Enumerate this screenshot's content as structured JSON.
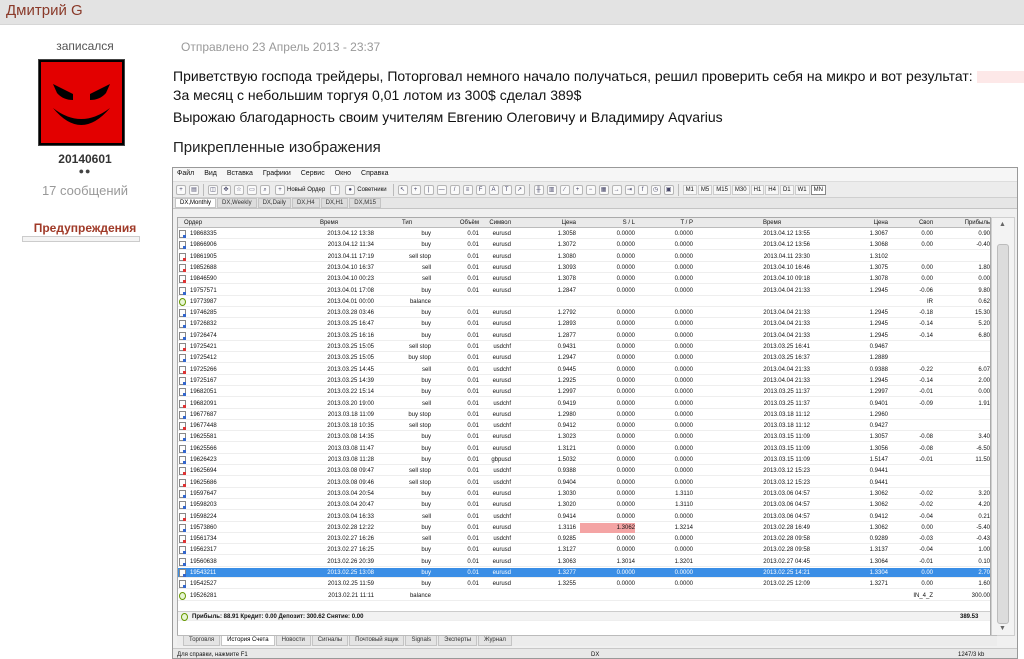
{
  "page": {
    "author": "Дмитрий G"
  },
  "user": {
    "joined_label": "записался",
    "user_id": "20140601",
    "dots": "●●",
    "messages": "17 сообщений",
    "warnings_label": "Предупреждения"
  },
  "post": {
    "date": "Отправлено 23 Апрель 2013 - 23:37",
    "line1": "Приветствую господа трейдеры, Поторговал  немного начало получаться, решил проверить себя на микро и вот результат:",
    "line2": "За месяц с небольшим торгуя 0,01 лотом из 300$ сделал 389$",
    "line3": "Вырожаю благодарность своим учителям Евгению Олеговичу и Владимиру Aqvarius",
    "attachments_title": "Прикрепленные изображения"
  },
  "terminal": {
    "menu": [
      "Файл",
      "Вид",
      "Вставка",
      "Графики",
      "Сервис",
      "Окно",
      "Справка"
    ],
    "toolbar": {
      "new_order": "Новый Ордер",
      "advisors": "Советники",
      "timeframes": [
        "M1",
        "M5",
        "M15",
        "M30",
        "H1",
        "H4",
        "D1",
        "W1",
        "MN"
      ]
    },
    "chart_tabs": [
      "DX,Monthly",
      "DX,Weekly",
      "DX,Daily",
      "DX,H4",
      "DX,H1",
      "DX,M15"
    ],
    "columns": [
      "Ордер",
      "Время",
      "Тип",
      "Объём",
      "Символ",
      "Цена",
      "S / L",
      "T / P",
      "Время",
      "Цена",
      "Своп",
      "Прибыль"
    ],
    "rows": [
      [
        "19868335",
        "2013.04.12 13:38",
        "buy",
        "0.01",
        "eurusd",
        "1.3058",
        "0.0000",
        "0.0000",
        "2013.04.12 13:55",
        "1.3067",
        "0.00",
        "0.90"
      ],
      [
        "19866906",
        "2013.04.12 11:34",
        "buy",
        "0.01",
        "eurusd",
        "1.3072",
        "0.0000",
        "0.0000",
        "2013.04.12 13:56",
        "1.3068",
        "0.00",
        "-0.40"
      ],
      [
        "19861905",
        "2013.04.11 17:19",
        "sell stop",
        "0.01",
        "eurusd",
        "1.3080",
        "0.0000",
        "0.0000",
        "2013.04.11 23:30",
        "1.3102",
        "",
        ""
      ],
      [
        "19852688",
        "2013.04.10 16:37",
        "sell",
        "0.01",
        "eurusd",
        "1.3093",
        "0.0000",
        "0.0000",
        "2013.04.10 16:46",
        "1.3075",
        "0.00",
        "1.80"
      ],
      [
        "19846590",
        "2013.04.10 00:23",
        "sell",
        "0.01",
        "eurusd",
        "1.3078",
        "0.0000",
        "0.0000",
        "2013.04.10 09:18",
        "1.3078",
        "0.00",
        "0.00"
      ],
      [
        "19757571",
        "2013.04.01 17:08",
        "buy",
        "0.01",
        "eurusd",
        "1.2847",
        "0.0000",
        "0.0000",
        "2013.04.04 21:33",
        "1.2945",
        "-0.06",
        "9.80"
      ],
      [
        "19773987",
        "2013.04.01 00:00",
        "balance",
        "",
        "",
        "",
        "",
        "",
        "",
        "",
        "IR",
        "0.62"
      ],
      [
        "19746285",
        "2013.03.28 03:46",
        "buy",
        "0.01",
        "eurusd",
        "1.2792",
        "0.0000",
        "0.0000",
        "2013.04.04 21:33",
        "1.2945",
        "-0.18",
        "15.30"
      ],
      [
        "19726832",
        "2013.03.25 16:47",
        "buy",
        "0.01",
        "eurusd",
        "1.2893",
        "0.0000",
        "0.0000",
        "2013.04.04 21:33",
        "1.2945",
        "-0.14",
        "5.20"
      ],
      [
        "19726474",
        "2013.03.25 16:16",
        "buy",
        "0.01",
        "eurusd",
        "1.2877",
        "0.0000",
        "0.0000",
        "2013.04.04 21:33",
        "1.2945",
        "-0.14",
        "6.80"
      ],
      [
        "19725421",
        "2013.03.25 15:05",
        "sell stop",
        "0.01",
        "usdchf",
        "0.9431",
        "0.0000",
        "0.0000",
        "2013.03.25 16:41",
        "0.9467",
        "",
        ""
      ],
      [
        "19725412",
        "2013.03.25 15:05",
        "buy stop",
        "0.01",
        "eurusd",
        "1.2947",
        "0.0000",
        "0.0000",
        "2013.03.25 16:37",
        "1.2889",
        "",
        ""
      ],
      [
        "19725266",
        "2013.03.25 14:45",
        "sell",
        "0.01",
        "usdchf",
        "0.9445",
        "0.0000",
        "0.0000",
        "2013.04.04 21:33",
        "0.9388",
        "-0.22",
        "6.07"
      ],
      [
        "19725167",
        "2013.03.25 14:39",
        "buy",
        "0.01",
        "eurusd",
        "1.2925",
        "0.0000",
        "0.0000",
        "2013.04.04 21:33",
        "1.2945",
        "-0.14",
        "2.00"
      ],
      [
        "19682051",
        "2013.03.22 15:14",
        "buy",
        "0.01",
        "eurusd",
        "1.2997",
        "0.0000",
        "0.0000",
        "2013.03.25 11:37",
        "1.2997",
        "-0.01",
        "0.00"
      ],
      [
        "19682091",
        "2013.03.20 19:00",
        "sell",
        "0.01",
        "usdchf",
        "0.9419",
        "0.0000",
        "0.0000",
        "2013.03.25 11:37",
        "0.9401",
        "-0.09",
        "1.91"
      ],
      [
        "19677687",
        "2013.03.18 11:09",
        "buy stop",
        "0.01",
        "eurusd",
        "1.2980",
        "0.0000",
        "0.0000",
        "2013.03.18 11:12",
        "1.2960",
        "",
        ""
      ],
      [
        "19677448",
        "2013.03.18 10:35",
        "sell stop",
        "0.01",
        "usdchf",
        "0.9412",
        "0.0000",
        "0.0000",
        "2013.03.18 11:12",
        "0.9427",
        "",
        ""
      ],
      [
        "19625581",
        "2013.03.08 14:35",
        "buy",
        "0.01",
        "eurusd",
        "1.3023",
        "0.0000",
        "0.0000",
        "2013.03.15 11:09",
        "1.3057",
        "-0.08",
        "3.40"
      ],
      [
        "19625566",
        "2013.03.08 11:47",
        "buy",
        "0.01",
        "eurusd",
        "1.3121",
        "0.0000",
        "0.0000",
        "2013.03.15 11:09",
        "1.3056",
        "-0.08",
        "-6.50"
      ],
      [
        "19626423",
        "2013.03.08 11:28",
        "buy",
        "0.01",
        "gbpusd",
        "1.5032",
        "0.0000",
        "0.0000",
        "2013.03.15 11:09",
        "1.5147",
        "-0.01",
        "11.50"
      ],
      [
        "19625694",
        "2013.03.08 09:47",
        "sell stop",
        "0.01",
        "usdchf",
        "0.9388",
        "0.0000",
        "0.0000",
        "2013.03.12 15:23",
        "0.9441",
        "",
        ""
      ],
      [
        "19625686",
        "2013.03.08 09:46",
        "sell stop",
        "0.01",
        "usdchf",
        "0.9404",
        "0.0000",
        "0.0000",
        "2013.03.12 15:23",
        "0.9441",
        "",
        ""
      ],
      [
        "19597647",
        "2013.03.04 20:54",
        "buy",
        "0.01",
        "eurusd",
        "1.3030",
        "0.0000",
        "1.3110",
        "2013.03.06 04:57",
        "1.3062",
        "-0.02",
        "3.20"
      ],
      [
        "19598203",
        "2013.03.04 20:47",
        "buy",
        "0.01",
        "eurusd",
        "1.3020",
        "0.0000",
        "1.3110",
        "2013.03.06 04:57",
        "1.3062",
        "-0.02",
        "4.20"
      ],
      [
        "19598224",
        "2013.03.04 16:33",
        "sell",
        "0.01",
        "usdchf",
        "0.9414",
        "0.0000",
        "0.0000",
        "2013.03.06 04:57",
        "0.9412",
        "-0.04",
        "0.21"
      ],
      [
        "19573860",
        "2013.02.28 12:22",
        "buy",
        "0.01",
        "eurusd",
        "1.3116",
        "1.3062",
        "1.3214",
        "2013.02.28 16:49",
        "1.3062",
        "0.00",
        "-5.40"
      ],
      [
        "19561734",
        "2013.02.27 16:26",
        "sell",
        "0.01",
        "usdchf",
        "0.9285",
        "0.0000",
        "0.0000",
        "2013.02.28 09:58",
        "0.9289",
        "-0.03",
        "-0.43"
      ],
      [
        "19562317",
        "2013.02.27 16:25",
        "buy",
        "0.01",
        "eurusd",
        "1.3127",
        "0.0000",
        "0.0000",
        "2013.02.28 09:58",
        "1.3137",
        "-0.04",
        "1.00"
      ],
      [
        "19560638",
        "2013.02.26 20:39",
        "buy",
        "0.01",
        "eurusd",
        "1.3063",
        "1.3014",
        "1.3201",
        "2013.02.27 04:45",
        "1.3064",
        "-0.01",
        "0.10"
      ],
      [
        "19543211",
        "2013.02.25 13:08",
        "buy",
        "0.01",
        "eurusd",
        "1.3277",
        "0.0000",
        "0.0000",
        "2013.02.25 14:21",
        "1.3304",
        "0.00",
        "2.70"
      ],
      [
        "19542527",
        "2013.02.25 11:59",
        "buy",
        "0.01",
        "eurusd",
        "1.3255",
        "0.0000",
        "0.0000",
        "2013.02.25 12:09",
        "1.3271",
        "0.00",
        "1.60"
      ],
      [
        "19526281",
        "2013.02.21 11:11",
        "balance",
        "",
        "",
        "",
        "",
        "",
        "",
        "",
        "IN_4_Z",
        "300.00"
      ]
    ],
    "selected_row": 30,
    "highlight": {
      "row": 26,
      "col": 6
    },
    "summary": {
      "text": "Прибыль: 88.91  Кредит: 0.00  Депозит: 300.62  Снятие: 0.00",
      "total": "389.53"
    },
    "bottom_tabs": [
      "Торговля",
      "История Счета",
      "Новости",
      "Сигналы",
      "Почтовый ящик",
      "Signals",
      "Эксперты",
      "Журнал"
    ],
    "active_bottom_tab": 1,
    "status": {
      "help": "Для справки, нажмите F1",
      "profile": "DX",
      "traffic": "1247/3 kb"
    }
  },
  "colors": {
    "header_bg": "#e3e3e3",
    "author": "#8a3a2a",
    "warning": "#a03a28",
    "selected_row": "#3a8ee6",
    "sl_highlight": "#f4a4a4",
    "avatar": "#e30000"
  }
}
